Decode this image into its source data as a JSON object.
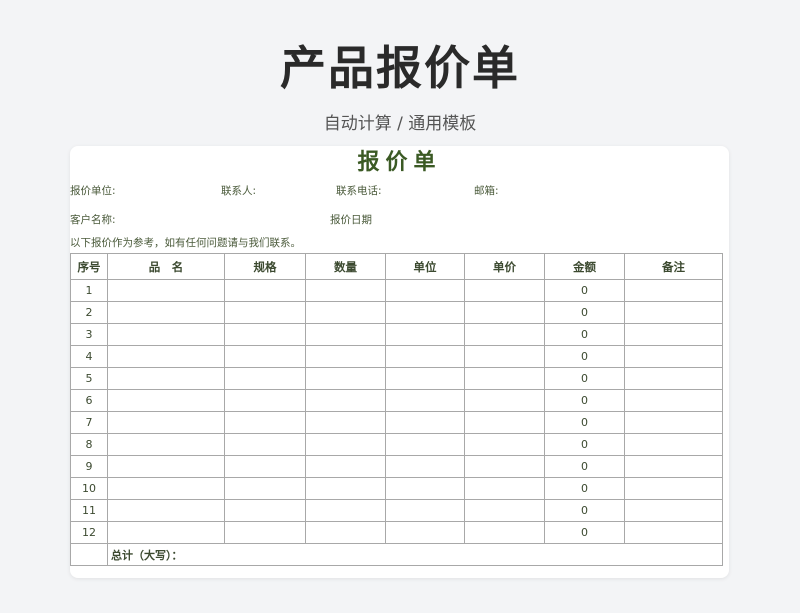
{
  "header": {
    "title": "产品报价单",
    "subtitle": "自动计算  / 通用模板"
  },
  "sheet": {
    "title": "报价单",
    "info": {
      "quote_unit": "报价单位:",
      "contact": "联系人:",
      "phone": "联系电话:",
      "email": "邮箱:",
      "customer": "客户名称:",
      "date": "报价日期"
    },
    "note": "以下报价作为参考，如有任何问题请与我们联系。",
    "columns": [
      "序号",
      "品　名",
      "规格",
      "数量",
      "单位",
      "单价",
      "金额",
      "备注"
    ],
    "rows": [
      {
        "no": "1",
        "amount": "0"
      },
      {
        "no": "2",
        "amount": "0"
      },
      {
        "no": "3",
        "amount": "0"
      },
      {
        "no": "4",
        "amount": "0"
      },
      {
        "no": "5",
        "amount": "0"
      },
      {
        "no": "6",
        "amount": "0"
      },
      {
        "no": "7",
        "amount": "0"
      },
      {
        "no": "8",
        "amount": "0"
      },
      {
        "no": "9",
        "amount": "0"
      },
      {
        "no": "10",
        "amount": "0"
      },
      {
        "no": "11",
        "amount": "0"
      },
      {
        "no": "12",
        "amount": "0"
      }
    ],
    "total_label": "总计（大写）："
  },
  "colors": {
    "accent": "#3b5a24",
    "text": "#4a5a3a",
    "border": "#a8a8a8",
    "background": "#f3f4f6"
  }
}
